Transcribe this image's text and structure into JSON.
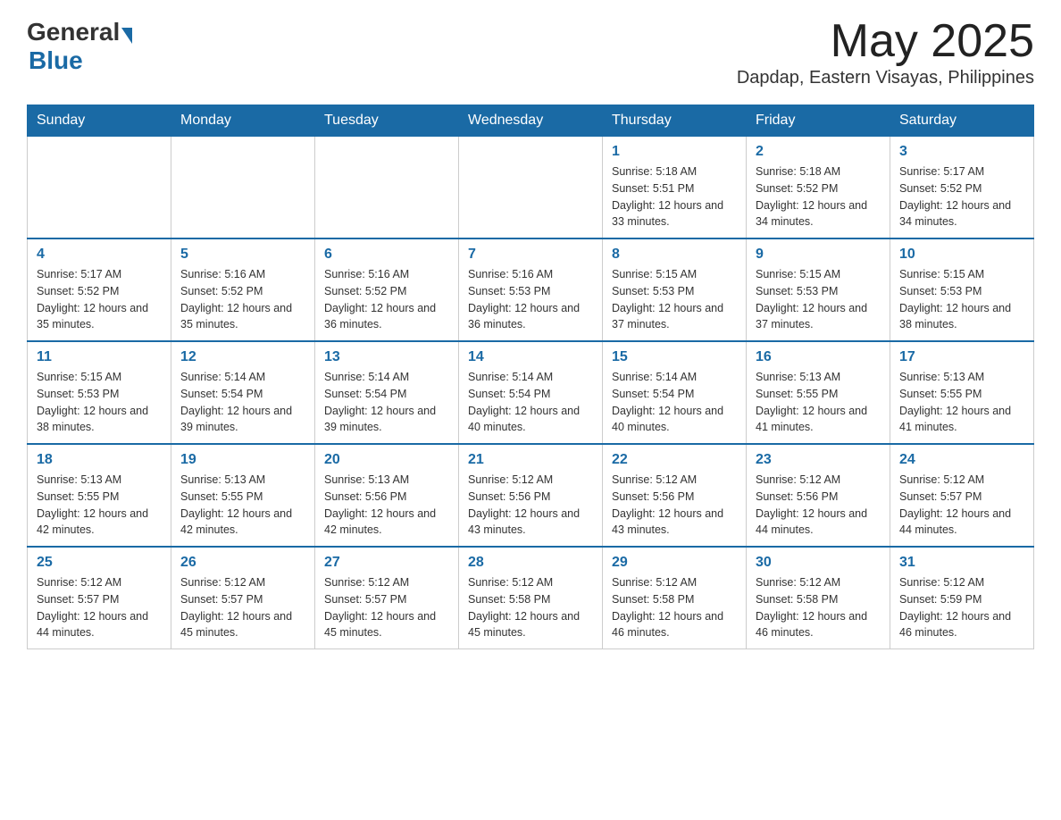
{
  "header": {
    "logo_general": "General",
    "logo_blue": "Blue",
    "title": "May 2025",
    "location": "Dapdap, Eastern Visayas, Philippines"
  },
  "weekdays": [
    "Sunday",
    "Monday",
    "Tuesday",
    "Wednesday",
    "Thursday",
    "Friday",
    "Saturday"
  ],
  "weeks": [
    [
      {
        "day": "",
        "sunrise": "",
        "sunset": "",
        "daylight": ""
      },
      {
        "day": "",
        "sunrise": "",
        "sunset": "",
        "daylight": ""
      },
      {
        "day": "",
        "sunrise": "",
        "sunset": "",
        "daylight": ""
      },
      {
        "day": "",
        "sunrise": "",
        "sunset": "",
        "daylight": ""
      },
      {
        "day": "1",
        "sunrise": "Sunrise: 5:18 AM",
        "sunset": "Sunset: 5:51 PM",
        "daylight": "Daylight: 12 hours and 33 minutes."
      },
      {
        "day": "2",
        "sunrise": "Sunrise: 5:18 AM",
        "sunset": "Sunset: 5:52 PM",
        "daylight": "Daylight: 12 hours and 34 minutes."
      },
      {
        "day": "3",
        "sunrise": "Sunrise: 5:17 AM",
        "sunset": "Sunset: 5:52 PM",
        "daylight": "Daylight: 12 hours and 34 minutes."
      }
    ],
    [
      {
        "day": "4",
        "sunrise": "Sunrise: 5:17 AM",
        "sunset": "Sunset: 5:52 PM",
        "daylight": "Daylight: 12 hours and 35 minutes."
      },
      {
        "day": "5",
        "sunrise": "Sunrise: 5:16 AM",
        "sunset": "Sunset: 5:52 PM",
        "daylight": "Daylight: 12 hours and 35 minutes."
      },
      {
        "day": "6",
        "sunrise": "Sunrise: 5:16 AM",
        "sunset": "Sunset: 5:52 PM",
        "daylight": "Daylight: 12 hours and 36 minutes."
      },
      {
        "day": "7",
        "sunrise": "Sunrise: 5:16 AM",
        "sunset": "Sunset: 5:53 PM",
        "daylight": "Daylight: 12 hours and 36 minutes."
      },
      {
        "day": "8",
        "sunrise": "Sunrise: 5:15 AM",
        "sunset": "Sunset: 5:53 PM",
        "daylight": "Daylight: 12 hours and 37 minutes."
      },
      {
        "day": "9",
        "sunrise": "Sunrise: 5:15 AM",
        "sunset": "Sunset: 5:53 PM",
        "daylight": "Daylight: 12 hours and 37 minutes."
      },
      {
        "day": "10",
        "sunrise": "Sunrise: 5:15 AM",
        "sunset": "Sunset: 5:53 PM",
        "daylight": "Daylight: 12 hours and 38 minutes."
      }
    ],
    [
      {
        "day": "11",
        "sunrise": "Sunrise: 5:15 AM",
        "sunset": "Sunset: 5:53 PM",
        "daylight": "Daylight: 12 hours and 38 minutes."
      },
      {
        "day": "12",
        "sunrise": "Sunrise: 5:14 AM",
        "sunset": "Sunset: 5:54 PM",
        "daylight": "Daylight: 12 hours and 39 minutes."
      },
      {
        "day": "13",
        "sunrise": "Sunrise: 5:14 AM",
        "sunset": "Sunset: 5:54 PM",
        "daylight": "Daylight: 12 hours and 39 minutes."
      },
      {
        "day": "14",
        "sunrise": "Sunrise: 5:14 AM",
        "sunset": "Sunset: 5:54 PM",
        "daylight": "Daylight: 12 hours and 40 minutes."
      },
      {
        "day": "15",
        "sunrise": "Sunrise: 5:14 AM",
        "sunset": "Sunset: 5:54 PM",
        "daylight": "Daylight: 12 hours and 40 minutes."
      },
      {
        "day": "16",
        "sunrise": "Sunrise: 5:13 AM",
        "sunset": "Sunset: 5:55 PM",
        "daylight": "Daylight: 12 hours and 41 minutes."
      },
      {
        "day": "17",
        "sunrise": "Sunrise: 5:13 AM",
        "sunset": "Sunset: 5:55 PM",
        "daylight": "Daylight: 12 hours and 41 minutes."
      }
    ],
    [
      {
        "day": "18",
        "sunrise": "Sunrise: 5:13 AM",
        "sunset": "Sunset: 5:55 PM",
        "daylight": "Daylight: 12 hours and 42 minutes."
      },
      {
        "day": "19",
        "sunrise": "Sunrise: 5:13 AM",
        "sunset": "Sunset: 5:55 PM",
        "daylight": "Daylight: 12 hours and 42 minutes."
      },
      {
        "day": "20",
        "sunrise": "Sunrise: 5:13 AM",
        "sunset": "Sunset: 5:56 PM",
        "daylight": "Daylight: 12 hours and 42 minutes."
      },
      {
        "day": "21",
        "sunrise": "Sunrise: 5:12 AM",
        "sunset": "Sunset: 5:56 PM",
        "daylight": "Daylight: 12 hours and 43 minutes."
      },
      {
        "day": "22",
        "sunrise": "Sunrise: 5:12 AM",
        "sunset": "Sunset: 5:56 PM",
        "daylight": "Daylight: 12 hours and 43 minutes."
      },
      {
        "day": "23",
        "sunrise": "Sunrise: 5:12 AM",
        "sunset": "Sunset: 5:56 PM",
        "daylight": "Daylight: 12 hours and 44 minutes."
      },
      {
        "day": "24",
        "sunrise": "Sunrise: 5:12 AM",
        "sunset": "Sunset: 5:57 PM",
        "daylight": "Daylight: 12 hours and 44 minutes."
      }
    ],
    [
      {
        "day": "25",
        "sunrise": "Sunrise: 5:12 AM",
        "sunset": "Sunset: 5:57 PM",
        "daylight": "Daylight: 12 hours and 44 minutes."
      },
      {
        "day": "26",
        "sunrise": "Sunrise: 5:12 AM",
        "sunset": "Sunset: 5:57 PM",
        "daylight": "Daylight: 12 hours and 45 minutes."
      },
      {
        "day": "27",
        "sunrise": "Sunrise: 5:12 AM",
        "sunset": "Sunset: 5:57 PM",
        "daylight": "Daylight: 12 hours and 45 minutes."
      },
      {
        "day": "28",
        "sunrise": "Sunrise: 5:12 AM",
        "sunset": "Sunset: 5:58 PM",
        "daylight": "Daylight: 12 hours and 45 minutes."
      },
      {
        "day": "29",
        "sunrise": "Sunrise: 5:12 AM",
        "sunset": "Sunset: 5:58 PM",
        "daylight": "Daylight: 12 hours and 46 minutes."
      },
      {
        "day": "30",
        "sunrise": "Sunrise: 5:12 AM",
        "sunset": "Sunset: 5:58 PM",
        "daylight": "Daylight: 12 hours and 46 minutes."
      },
      {
        "day": "31",
        "sunrise": "Sunrise: 5:12 AM",
        "sunset": "Sunset: 5:59 PM",
        "daylight": "Daylight: 12 hours and 46 minutes."
      }
    ]
  ],
  "colors": {
    "header_bg": "#1a6aa5",
    "header_text": "#ffffff",
    "day_number": "#1a6aa5",
    "border": "#1a6aa5"
  }
}
